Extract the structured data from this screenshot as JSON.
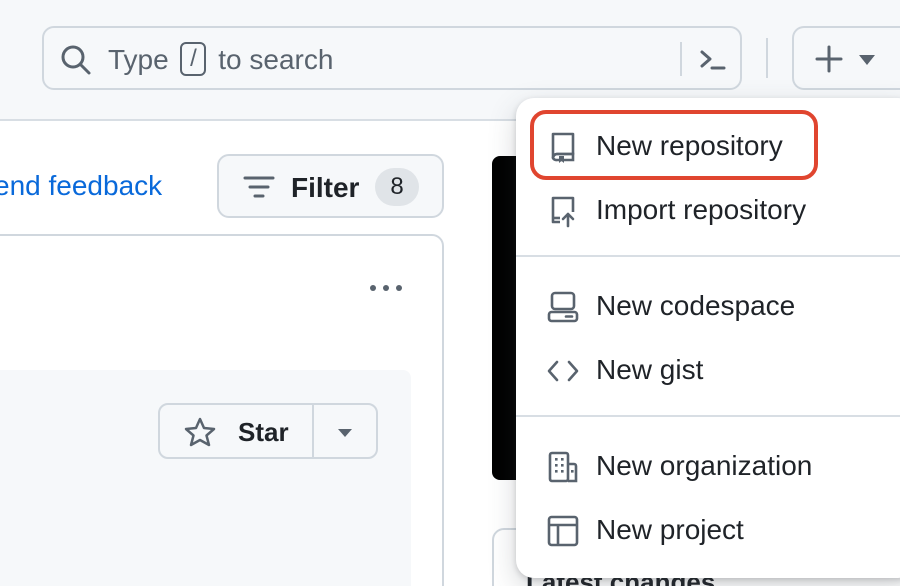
{
  "header": {
    "search": {
      "text_before": "Type",
      "key": "/",
      "text_after": "to search"
    },
    "icons": {
      "search": "search-icon",
      "command": "command-palette-icon",
      "plus": "plus-icon",
      "caret": "triangle-down-icon"
    }
  },
  "main": {
    "feedback_link": "end feedback",
    "filter": {
      "label": "Filter",
      "count": "8"
    },
    "card": {
      "star_label": "Star"
    }
  },
  "side": {
    "latest_changes": "Latest changes"
  },
  "create_menu": {
    "items": [
      {
        "label": "New repository",
        "icon": "repo-icon"
      },
      {
        "label": "Import repository",
        "icon": "repo-push-icon"
      },
      {
        "label": "New codespace",
        "icon": "codespace-icon"
      },
      {
        "label": "New gist",
        "icon": "code-icon"
      },
      {
        "label": "New organization",
        "icon": "organization-icon"
      },
      {
        "label": "New project",
        "icon": "table-icon"
      }
    ],
    "highlight_color": "#e0452f"
  },
  "colors": {
    "link": "#0969da",
    "border": "#d0d7de",
    "canvas_subtle": "#f6f8fa"
  }
}
